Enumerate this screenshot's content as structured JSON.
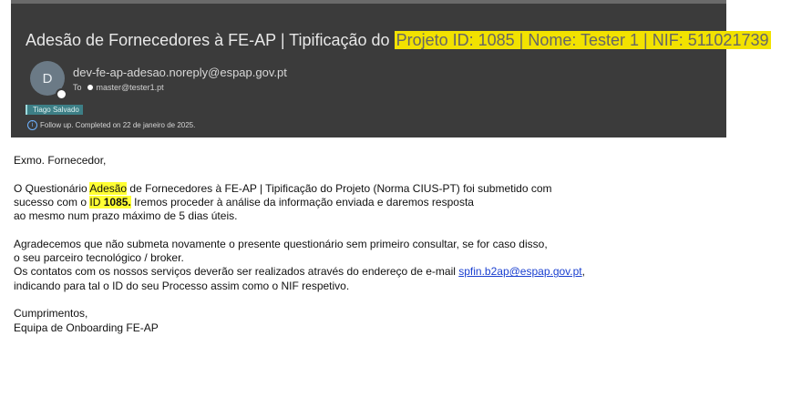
{
  "email": {
    "subject_prefix": "Adesão de Fornecedores à FE-AP | Tipificação do ",
    "subject_highlight": "Projeto ID: 1085 | Nome: Tester 1 | NIF: 511021739",
    "avatar_initial": "D",
    "sender": "dev-fe-ap-adesao.noreply@espap.gov.pt",
    "to_label": "To",
    "recipient": "master@tester1.pt",
    "category_tag": "Tiago Salvado",
    "followup_text": "Follow up.  Completed on 22 de janeiro de 2025."
  },
  "body": {
    "greeting": "Exmo. Fornecedor,",
    "p1_a": "O Questionário ",
    "p1_hl": "Adesão",
    "p1_b": " de Fornecedores à FE-AP | Tipificação do Projeto (Norma CIUS-PT) foi submetido com",
    "p1_c": "sucesso com o ",
    "p1_id_prefix": "ID ",
    "p1_id": "1085.",
    "p1_d": " Iremos proceder à análise da informação enviada e daremos resposta",
    "p1_e": "ao mesmo num prazo máximo de 5 dias úteis.",
    "p2_a": "Agradecemos que não submeta novamente o presente questionário sem primeiro consultar, se for caso disso,",
    "p2_b": "o seu parceiro tecnológico / broker.",
    "p2_c": "Os contatos com os nossos serviços deverão ser realizados através do endereço de e-mail ",
    "p2_link": "spfin.b2ap@espap.gov.pt",
    "p2_c_end": ",",
    "p2_d": "indicando para tal o ID do seu Processo assim como o NIF respetivo.",
    "closing": "Cumprimentos,",
    "signature": "Equipa de Onboarding FE-AP"
  }
}
